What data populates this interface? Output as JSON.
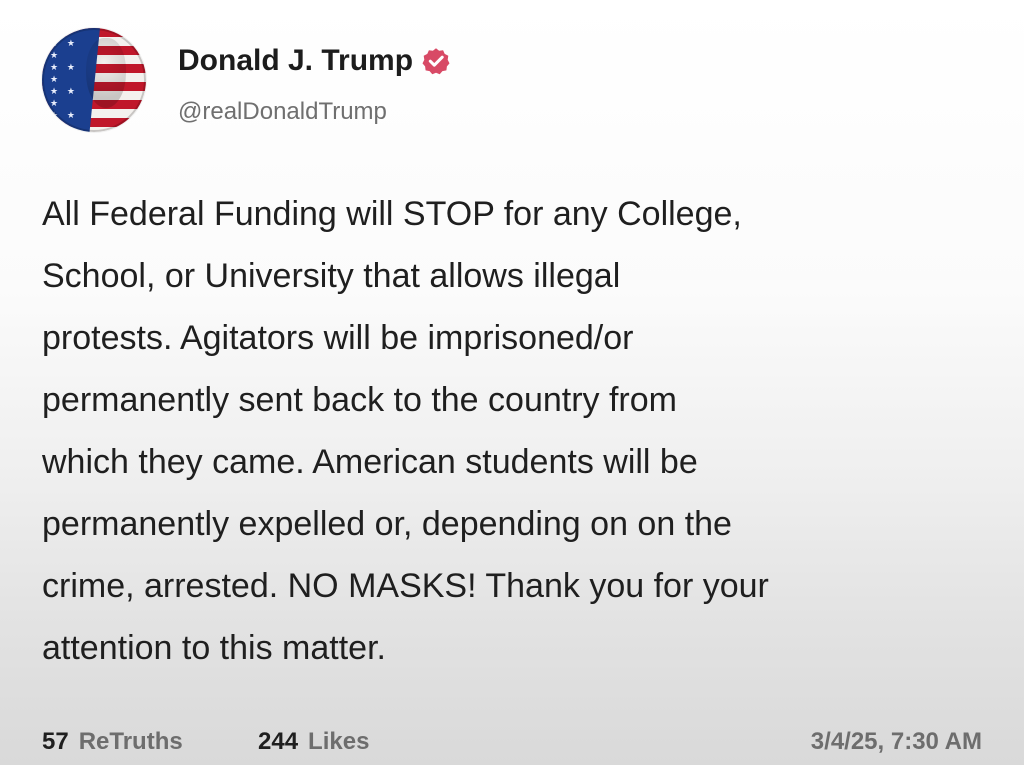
{
  "profile": {
    "name": "Donald J. Trump",
    "handle": "@realDonaldTrump",
    "avatar_icon": "profile-avatar-icon",
    "verified_icon": "verified-badge-icon",
    "verified_color": "#d84a66"
  },
  "post": {
    "lines": [
      "All Federal Funding will STOP for any College,",
      "School, or University that allows illegal",
      "protests. Agitators will be imprisoned/or",
      "permanently sent back to the country from",
      "which they came. American students will be",
      "permanently expelled or, depending on on the",
      "crime, arrested. NO MASKS! Thank you for your",
      "attention to this matter."
    ]
  },
  "footer": {
    "retruths_count": "57",
    "retruths_label": "ReTruths",
    "likes_count": "244",
    "likes_label": "Likes",
    "timestamp": "3/4/25, 7:30 AM"
  }
}
